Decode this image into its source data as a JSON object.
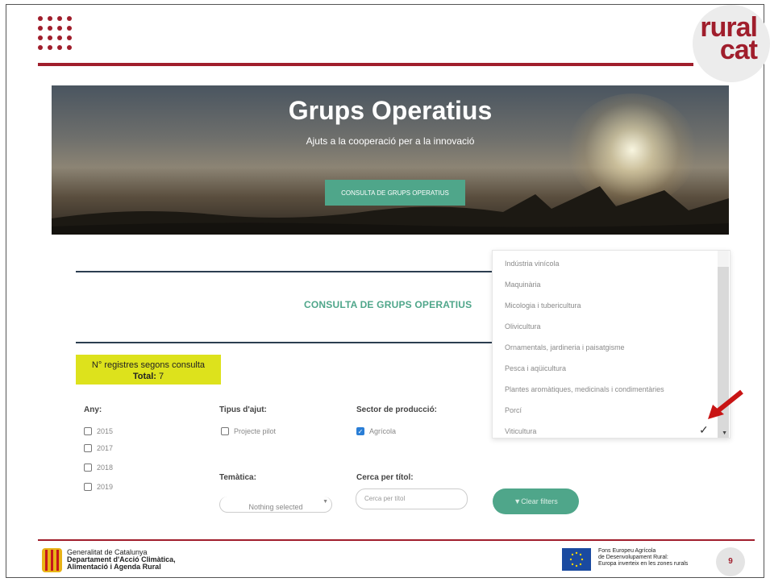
{
  "brand": {
    "logo_line1": "rural",
    "logo_line2": "cat",
    "accent": "#a01e2c",
    "green": "#4fa68a",
    "highlight": "#dde21c"
  },
  "hero": {
    "title": "Grups Operatius",
    "subtitle": "Ajuts a la cooperació per a la innovació",
    "button_label": "CONSULTA DE GRUPS OPERATIUS"
  },
  "consult": {
    "title": "CONSULTA DE GRUPS OPERATIUS",
    "count_label": "N° registres segons consulta",
    "total_label": "Total:",
    "total_value": "7"
  },
  "filters": {
    "any": {
      "label": "Any:",
      "options": [
        "2015",
        "2017",
        "2018",
        "2019"
      ]
    },
    "tipus": {
      "label": "Tipus d'ajut:",
      "options": [
        "Projecte pilot"
      ]
    },
    "sector": {
      "label": "Sector de producció:",
      "options": [
        "Agrícola"
      ],
      "checked": [
        "Agrícola"
      ]
    },
    "tematica": {
      "label": "Temàtica:",
      "value": "Nothing selected"
    },
    "cerca": {
      "label": "Cerca per títol:",
      "placeholder": "Cerca per títol"
    },
    "clear_label": "Clear filters"
  },
  "dropdown": {
    "items": [
      "Indústria vinícola",
      "Maquinària",
      "Micologia i tubericultura",
      "Olivicultura",
      "Ornamentals, jardineria i paisatgisme",
      "Pesca i aqüicultura",
      "Plantes aromàtiques, medicinals i condimentàries",
      "Porcí",
      "Viticultura"
    ],
    "selected": "Viticultura"
  },
  "footer": {
    "gen_line1": "Generalitat de Catalunya",
    "gen_line2": "Departament d'Acció Climàtica,",
    "gen_line3": "Alimentació i Agenda Rural",
    "eu_line1": "Fons Europeu Agrícola",
    "eu_line2": "de Desenvolupament Rural:",
    "eu_line3": "Europa inverteix en les zones rurals",
    "page_number": "9"
  }
}
